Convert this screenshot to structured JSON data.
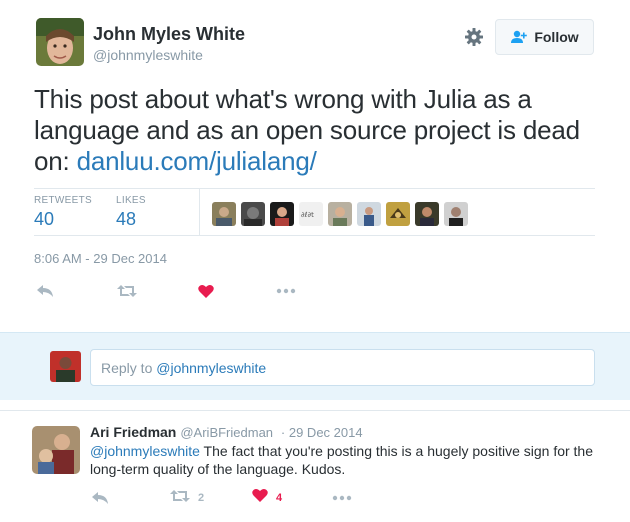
{
  "tweet": {
    "author_name": "John Myles White",
    "author_handle": "@johnmyleswhite",
    "follow_label": "Follow",
    "text_before_link": "This post about what's wrong with Julia as a language and as an open source project is dead on: ",
    "link_text": "danluu.com/julialang/",
    "stats": {
      "retweets_label": "RETWEETS",
      "retweets_value": "40",
      "likes_label": "LIKES",
      "likes_value": "48"
    },
    "timestamp": "8:06 AM - 29 Dec 2014",
    "actions": [
      "reply-icon",
      "retweet-icon",
      "heart-icon",
      "more-icon"
    ],
    "colors": {
      "link": "#2b7bb9",
      "heart": "#e81c4f",
      "muted": "#8899a6"
    }
  },
  "reply_box": {
    "placeholder_prefix": "Reply to ",
    "placeholder_mention": "@johnmyleswhite"
  },
  "reply": {
    "author_name": "Ari Friedman",
    "author_handle": "@AriBFriedman",
    "date": "· 29 Dec 2014",
    "mention": "@johnmyleswhite",
    "text": " The fact that you're posting this is a hugely positive sign for the long-term quality of the language. Kudos.",
    "retweet_count": "2",
    "like_count": "4"
  }
}
